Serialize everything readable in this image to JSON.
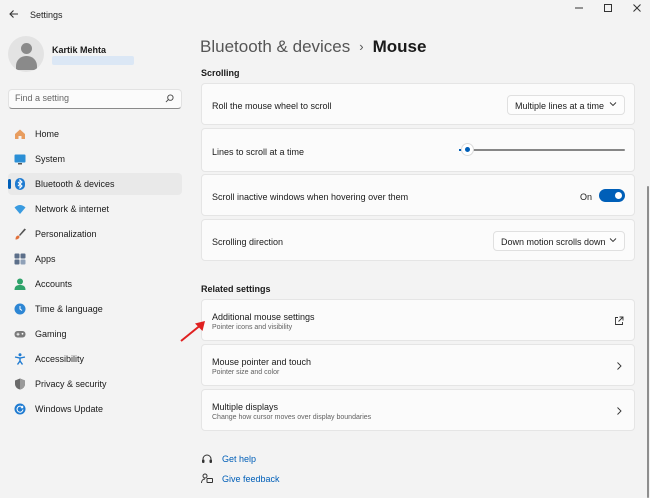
{
  "titlebar": {
    "app_title": "Settings"
  },
  "profile": {
    "name": "Kartik Mehta"
  },
  "search": {
    "placeholder": "Find a setting"
  },
  "nav": {
    "home": "Home",
    "system": "System",
    "bluetooth": "Bluetooth & devices",
    "network": "Network & internet",
    "personalization": "Personalization",
    "apps": "Apps",
    "accounts": "Accounts",
    "time": "Time & language",
    "gaming": "Gaming",
    "accessibility": "Accessibility",
    "privacy": "Privacy & security",
    "update": "Windows Update"
  },
  "breadcrumb": {
    "parent": "Bluetooth & devices",
    "separator": "›",
    "current": "Mouse"
  },
  "scrolling": {
    "section": "Scrolling",
    "roll_label": "Roll the mouse wheel to scroll",
    "roll_value": "Multiple lines at a time",
    "lines_label": "Lines to scroll at a time",
    "lines_fraction": 0.03,
    "inactive_label": "Scroll inactive windows when hovering over them",
    "inactive_state": "On",
    "direction_label": "Scrolling direction",
    "direction_value": "Down motion scrolls down"
  },
  "related": {
    "section": "Related settings",
    "additional_title": "Additional mouse settings",
    "additional_sub": "Pointer icons and visibility",
    "pointer_title": "Mouse pointer and touch",
    "pointer_sub": "Pointer size and color",
    "displays_title": "Multiple displays",
    "displays_sub": "Change how cursor moves over display boundaries"
  },
  "help": {
    "get_help": "Get help",
    "feedback": "Give feedback"
  },
  "colors": {
    "accent": "#005fb8",
    "annotation_arrow": "#e02020"
  }
}
